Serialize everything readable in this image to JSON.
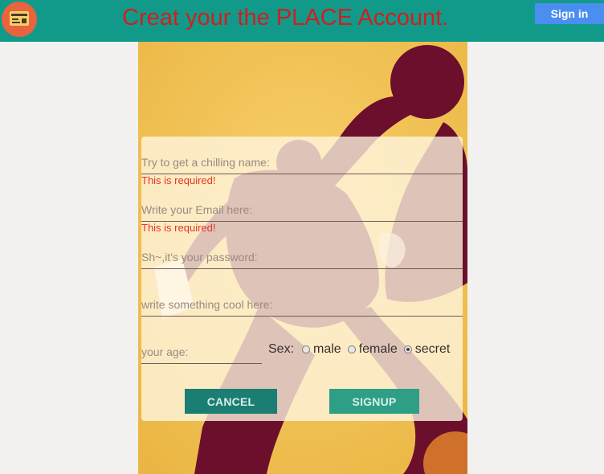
{
  "header": {
    "title": "Creat your the PLACE Account.",
    "signin_label": "Sign in",
    "logo_icon": "credit-card-icon",
    "colors": {
      "bar": "#119a8a",
      "title": "#d01f1f",
      "signin": "#4a8ef0",
      "logo": "#e8643c"
    }
  },
  "form": {
    "name_placeholder": "Try to get a chilling name:",
    "name_error": "This is required!",
    "email_placeholder": "Write your Email here:",
    "email_error": "This is required!",
    "password_placeholder": "Sh~,it's your password:",
    "bio_placeholder": "write something cool here:",
    "age_placeholder": "your age:",
    "sex_label": "Sex:",
    "sex_options": [
      "male",
      "female",
      "secret"
    ],
    "sex_selected": "secret",
    "cancel_label": "CANCEL",
    "signup_label": "SIGNUP",
    "colors": {
      "error": "#e53622",
      "cancel": "#1b7e73",
      "signup": "#2e9f86"
    }
  }
}
